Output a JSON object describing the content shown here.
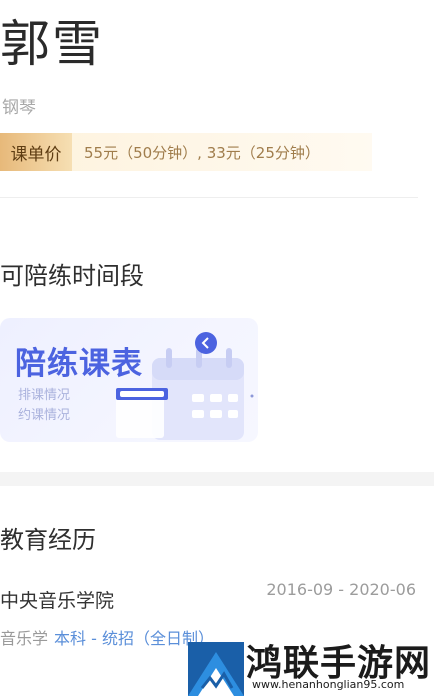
{
  "teacher": {
    "name": "郭雪",
    "instrument": "钢琴"
  },
  "price": {
    "tag": "课单价",
    "detail": "55元（50分钟）, 33元（25分钟）"
  },
  "availability": {
    "section_title": "可陪练时间段",
    "card_title": "陪练课表",
    "card_line1": "排课情况",
    "card_line2": "约课情况",
    "accent_color": "#4c63e0"
  },
  "education": {
    "section_title": "教育经历",
    "school": "中央音乐学院",
    "dates": "2016-09 - 2020-06",
    "major": "音乐学",
    "degree": "本科 - 统招（全日制）"
  },
  "watermark": {
    "title": "鸿联手游网",
    "url": "www.henanhonglian95.com"
  }
}
